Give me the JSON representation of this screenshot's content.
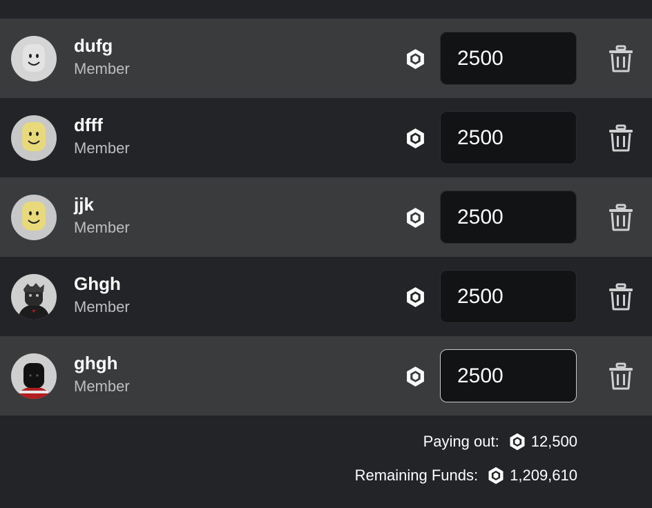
{
  "members": [
    {
      "name": "dufg",
      "role": "Member",
      "amount": "2500",
      "avatar": "classic-smiley-gray-avatar"
    },
    {
      "name": "dfff",
      "role": "Member",
      "amount": "2500",
      "avatar": "classic-smiley-yellow-avatar"
    },
    {
      "name": "jjk",
      "role": "Member",
      "amount": "2500",
      "avatar": "classic-smiley-yellow-avatar"
    },
    {
      "name": "Ghgh",
      "role": "Member",
      "amount": "2500",
      "avatar": "dark-character-avatar"
    },
    {
      "name": "ghgh",
      "role": "Member",
      "amount": "2500",
      "avatar": "dark-character-avatar"
    }
  ],
  "summary": {
    "paying_out_label": "Paying out:",
    "paying_out_value": "12,500",
    "remaining_label": "Remaining Funds:",
    "remaining_value": "1,209,610"
  },
  "icons": {
    "currency": "robux-icon",
    "delete": "trash-icon"
  },
  "colors": {
    "row_light": "#393b3d",
    "row_dark": "#232427",
    "input_bg": "#121314",
    "text_primary": "#ffffff",
    "text_secondary": "#bdbebe"
  }
}
